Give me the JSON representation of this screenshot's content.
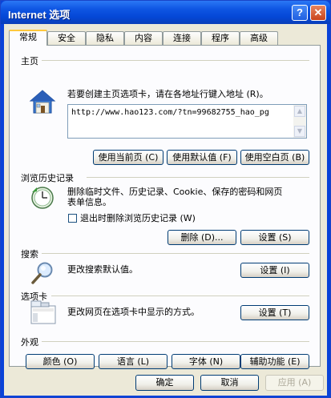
{
  "window": {
    "title": "Internet 选项",
    "help_glyph": "?",
    "close_glyph": "✕"
  },
  "tabs": [
    "常规",
    "安全",
    "隐私",
    "内容",
    "连接",
    "程序",
    "高级"
  ],
  "home": {
    "title": "主页",
    "desc": "若要创建主页选项卡，请在各地址行键入地址 (R)。",
    "url": "http://www.hao123.com/?tn=99682755_hao_pg",
    "btn_current": "使用当前页 (C)",
    "btn_default": "使用默认值 (F)",
    "btn_blank": "使用空白页 (B)"
  },
  "history": {
    "title": "浏览历史记录",
    "desc_line1": "删除临时文件、历史记录、Cookie、保存的密码和网页",
    "desc_line2": "表单信息。",
    "checkbox_label": "退出时删除浏览历史记录 (W)",
    "checkbox_checked": false,
    "btn_delete": "删除 (D)...",
    "btn_settings": "设置 (S)"
  },
  "search": {
    "title": "搜索",
    "desc": "更改搜索默认值。",
    "btn_settings": "设置 (I)"
  },
  "tabs_section": {
    "title": "选项卡",
    "desc": "更改网页在选项卡中显示的方式。",
    "btn_settings": "设置 (T)"
  },
  "appearance": {
    "title": "外观",
    "btn_colors": "颜色 (O)",
    "btn_languages": "语言 (L)",
    "btn_fonts": "字体 (N)",
    "btn_accessibility": "辅助功能 (E)"
  },
  "footer": {
    "ok": "确定",
    "cancel": "取消",
    "apply": "应用 (A)"
  },
  "colors": {
    "titlebar": "#0447d6",
    "dialog_bg": "#ece9d8",
    "panel_bg": "#fcfcfe",
    "button_border": "#003c74",
    "active_tab_accent": "#ffc83c"
  }
}
